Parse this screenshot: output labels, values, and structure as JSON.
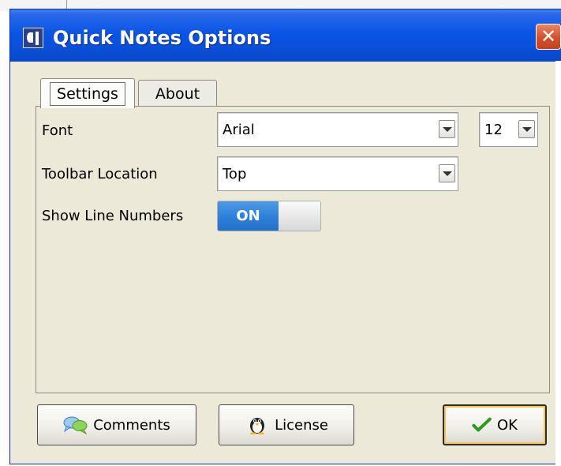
{
  "window": {
    "title": "Quick Notes Options",
    "close_symbol": "✕"
  },
  "tabs": [
    {
      "label": "Settings",
      "active": true
    },
    {
      "label": "About",
      "active": false
    }
  ],
  "settings": {
    "font_label": "Font",
    "font_value": "Arial",
    "font_size_value": "12",
    "toolbar_location_label": "Toolbar Location",
    "toolbar_location_value": "Top",
    "show_line_numbers_label": "Show Line Numbers",
    "show_line_numbers_state": "ON"
  },
  "buttons": {
    "comments_label": "Comments",
    "license_label": "License",
    "ok_label": "OK"
  },
  "icons": {
    "app": "quick-notes-app-icon",
    "comments": "speech-bubbles-icon",
    "license": "penguin-icon",
    "ok": "checkmark-icon",
    "dropdown": "chevron-down-icon"
  },
  "colors": {
    "titlebar": "#0a55e6",
    "close_button": "#d2502a",
    "toggle_on": "#2e7fd9",
    "window_face": "#ece9d8"
  }
}
